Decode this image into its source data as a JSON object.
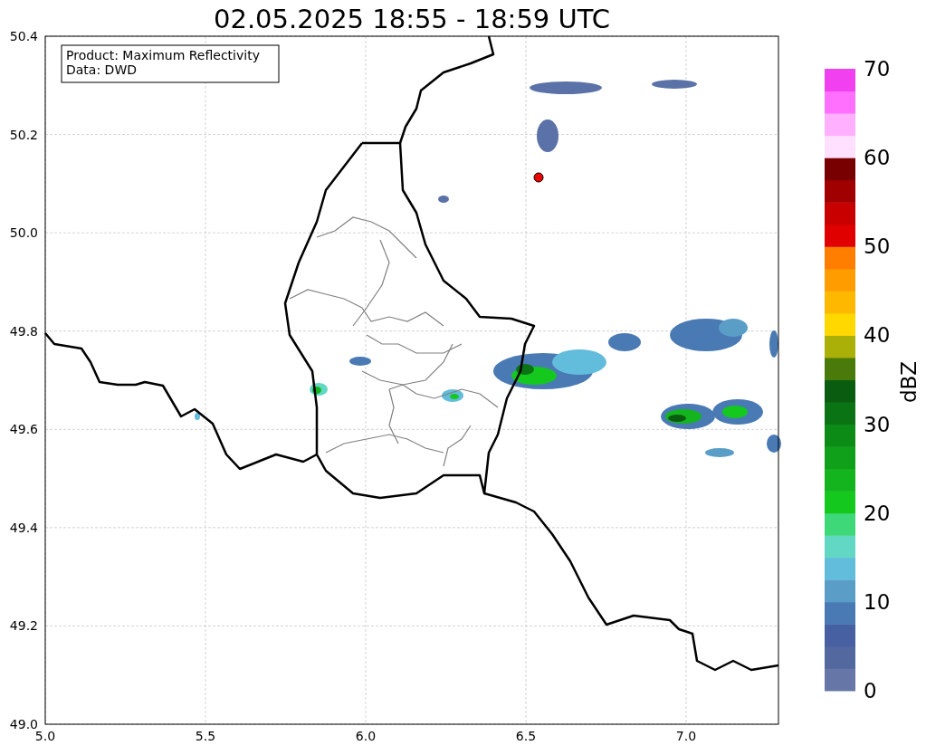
{
  "title": "02.05.2025 18:55 - 18:59 UTC",
  "info_box": {
    "lines": [
      "Product: Maximum Reflectivity",
      "Data: DWD"
    ]
  },
  "map": {
    "xticks": [
      "5.0",
      "5.5",
      "6.0",
      "6.5",
      "7.0"
    ],
    "yticks": [
      "50.4",
      "50.2",
      "50.0",
      "49.8",
      "49.6",
      "49.4",
      "49.2",
      "49.0"
    ]
  },
  "colorbar": {
    "label": "dBZ",
    "ticks": [
      "70",
      "60",
      "50",
      "40",
      "30",
      "20",
      "10",
      "0"
    ],
    "bins": [
      {
        "color": "#6676a6"
      },
      {
        "color": "#5468a0"
      },
      {
        "color": "#4660a2"
      },
      {
        "color": "#4a7ab4"
      },
      {
        "color": "#5a9ec8"
      },
      {
        "color": "#62bcdc"
      },
      {
        "color": "#62d8c4"
      },
      {
        "color": "#3ed878"
      },
      {
        "color": "#14c81e"
      },
      {
        "color": "#14b41e"
      },
      {
        "color": "#10a01a"
      },
      {
        "color": "#0c8c16"
      },
      {
        "color": "#0a7414"
      },
      {
        "color": "#0a5c10"
      },
      {
        "color": "#4a7a0a"
      },
      {
        "color": "#aab008"
      },
      {
        "color": "#ffd800"
      },
      {
        "color": "#ffb800"
      },
      {
        "color": "#ff9c00"
      },
      {
        "color": "#ff7e00"
      },
      {
        "color": "#e00000"
      },
      {
        "color": "#c80000"
      },
      {
        "color": "#a00000"
      },
      {
        "color": "#780000"
      },
      {
        "color": "#ffe0ff"
      },
      {
        "color": "#ffb0ff"
      },
      {
        "color": "#ff70ff"
      },
      {
        "color": "#f040f0"
      }
    ]
  }
}
